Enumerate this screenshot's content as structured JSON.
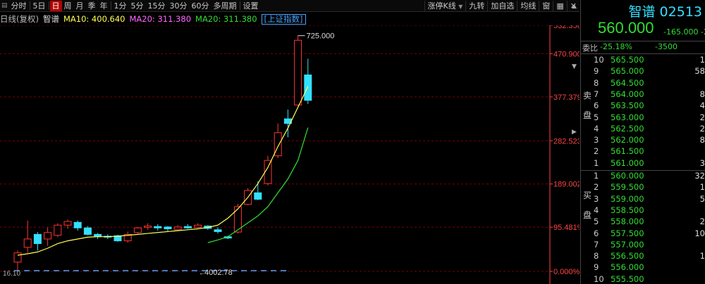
{
  "toolbar": {
    "left_items": [
      "分时",
      "5日",
      "日",
      "周",
      "月",
      "季",
      "年",
      "1分",
      "5分",
      "15分",
      "30分",
      "60分",
      "多周期",
      "设置"
    ],
    "active_item": "日",
    "right_items": [
      "涨停K线",
      "九转",
      "加自选",
      "均线",
      "窗"
    ]
  },
  "legend": {
    "period": "日线(复权)",
    "name": "智谱",
    "ma10": "MA10: 400.640",
    "ma20": "MA20: 311.380",
    "ma20b": "MA20: 311.380",
    "index_button": "[上证指数]"
  },
  "colors": {
    "up": "#ff3333",
    "down": "#33e0ff",
    "ma_a": "#ffff55",
    "ma_b": "#33dd33",
    "grid": "#7a0000",
    "axis_text": "#ff4444"
  },
  "quote": {
    "name": "智谱 02513",
    "price": "560.000",
    "change": "-165.000",
    "change_extra": "-2",
    "wei_bi_label": "委比",
    "wei_bi": "-25.18%",
    "wei_cha": "-3500"
  },
  "orderbook": {
    "sell_label_1": "卖",
    "sell_label_2": "盘",
    "buy_label_1": "买",
    "buy_label_2": "盘",
    "asks": [
      {
        "level": "10",
        "price": "565.500",
        "vol": "1"
      },
      {
        "level": "9",
        "price": "565.000",
        "vol": "58"
      },
      {
        "level": "8",
        "price": "564.500",
        "vol": ""
      },
      {
        "level": "7",
        "price": "564.000",
        "vol": "8"
      },
      {
        "level": "6",
        "price": "563.500",
        "vol": "4"
      },
      {
        "level": "5",
        "price": "563.000",
        "vol": "2"
      },
      {
        "level": "4",
        "price": "562.500",
        "vol": "2"
      },
      {
        "level": "3",
        "price": "562.000",
        "vol": "8"
      },
      {
        "level": "2",
        "price": "561.500",
        "vol": ""
      },
      {
        "level": "1",
        "price": "561.000",
        "vol": "3"
      }
    ],
    "bids": [
      {
        "level": "1",
        "price": "560.000",
        "vol": "32"
      },
      {
        "level": "2",
        "price": "559.500",
        "vol": "1"
      },
      {
        "level": "3",
        "price": "559.000",
        "vol": "5"
      },
      {
        "level": "4",
        "price": "558.500",
        "vol": ""
      },
      {
        "level": "5",
        "price": "558.000",
        "vol": "2"
      },
      {
        "level": "6",
        "price": "557.500",
        "vol": "10"
      },
      {
        "level": "7",
        "price": "557.000",
        "vol": ""
      },
      {
        "level": "8",
        "price": "556.500",
        "vol": "1"
      },
      {
        "level": "9",
        "price": "556.000",
        "vol": ""
      },
      {
        "level": "10",
        "price": "555.500",
        "vol": ""
      }
    ]
  },
  "chart_data": {
    "type": "candlestick",
    "y_axis_labels": [
      "532.356%",
      "470.900%",
      "377.379%",
      "282.523%",
      "189.002%",
      "95.481%",
      "0.000%"
    ],
    "y_axis_values": [
      532.356,
      470.9,
      377.379,
      282.523,
      189.002,
      95.481,
      0.0
    ],
    "high_annotation": "725.000",
    "index_annotation": "4002.78",
    "low_annotation": "16.10",
    "grid": true,
    "candles": [
      {
        "o": 20,
        "c": 40,
        "h": 45,
        "l": 0
      },
      {
        "o": 52,
        "c": 70,
        "h": 110,
        "l": 40
      },
      {
        "o": 80,
        "c": 60,
        "h": 85,
        "l": 45
      },
      {
        "o": 70,
        "c": 84,
        "h": 95,
        "l": 55
      },
      {
        "o": 78,
        "c": 100,
        "h": 104,
        "l": 74
      },
      {
        "o": 100,
        "c": 108,
        "h": 112,
        "l": 92
      },
      {
        "o": 106,
        "c": 94,
        "h": 110,
        "l": 88
      },
      {
        "o": 94,
        "c": 80,
        "h": 98,
        "l": 78
      },
      {
        "o": 80,
        "c": 75,
        "h": 83,
        "l": 70
      },
      {
        "o": 76,
        "c": 74,
        "h": 80,
        "l": 70
      },
      {
        "o": 77,
        "c": 66,
        "h": 79,
        "l": 64
      },
      {
        "o": 66,
        "c": 80,
        "h": 86,
        "l": 62
      },
      {
        "o": 84,
        "c": 94,
        "h": 96,
        "l": 82
      },
      {
        "o": 95,
        "c": 98,
        "h": 104,
        "l": 90
      },
      {
        "o": 97,
        "c": 94,
        "h": 102,
        "l": 88
      },
      {
        "o": 96,
        "c": 92,
        "h": 98,
        "l": 86
      },
      {
        "o": 90,
        "c": 96,
        "h": 100,
        "l": 88
      },
      {
        "o": 97,
        "c": 94,
        "h": 102,
        "l": 92
      },
      {
        "o": 95,
        "c": 100,
        "h": 104,
        "l": 94
      },
      {
        "o": 98,
        "c": 93,
        "h": 100,
        "l": 90
      },
      {
        "o": 90,
        "c": 86,
        "h": 95,
        "l": 82
      },
      {
        "o": 75,
        "c": 72,
        "h": 77,
        "l": 70
      },
      {
        "o": 85,
        "c": 140,
        "h": 146,
        "l": 82
      },
      {
        "o": 145,
        "c": 175,
        "h": 180,
        "l": 143
      },
      {
        "o": 170,
        "c": 156,
        "h": 195,
        "l": 154
      },
      {
        "o": 190,
        "c": 240,
        "h": 250,
        "l": 186
      },
      {
        "o": 250,
        "c": 300,
        "h": 320,
        "l": 245
      },
      {
        "o": 330,
        "c": 320,
        "h": 350,
        "l": 290
      },
      {
        "o": 360,
        "c": 500,
        "h": 510,
        "l": 358
      },
      {
        "o": 425,
        "c": 370,
        "h": 460,
        "l": 362
      }
    ],
    "ma_a": [
      35,
      38,
      42,
      50,
      60,
      66,
      70,
      74,
      75,
      75,
      76,
      78,
      80,
      82,
      84,
      86,
      88,
      90,
      92,
      95,
      100,
      115,
      135,
      160,
      190,
      225,
      270,
      310,
      355,
      400
    ],
    "ma_b": [
      null,
      null,
      null,
      null,
      null,
      null,
      null,
      null,
      null,
      null,
      null,
      null,
      null,
      null,
      null,
      null,
      null,
      null,
      null,
      62,
      68,
      75,
      90,
      105,
      120,
      140,
      170,
      200,
      240,
      311
    ]
  }
}
